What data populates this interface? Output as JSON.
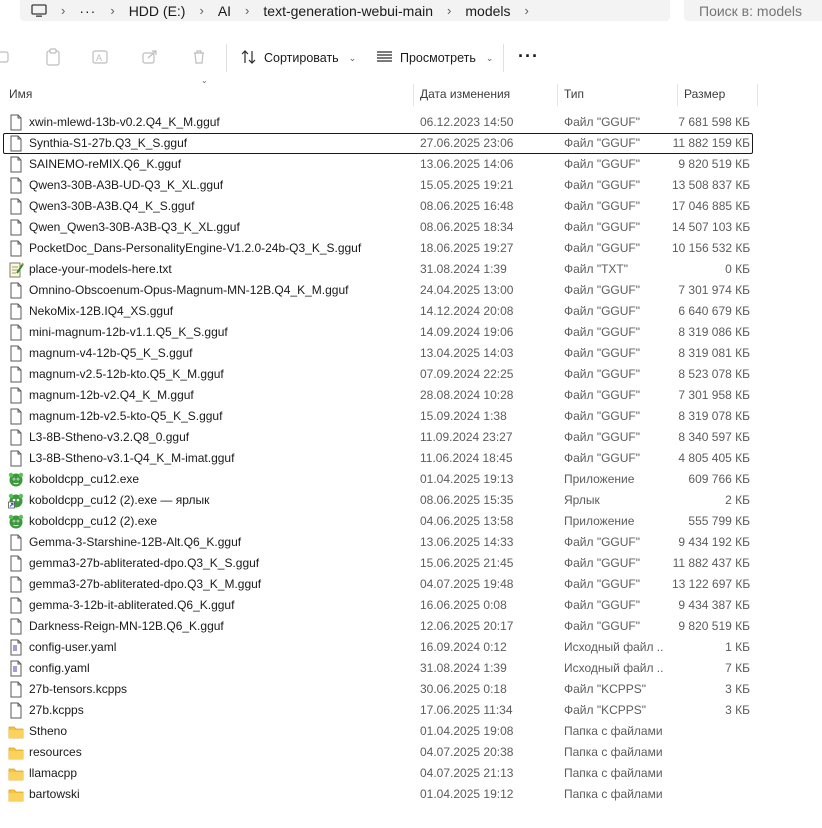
{
  "address": {
    "crumbs": [
      "HDD (E:)",
      "AI",
      "text-generation-webui-main",
      "models"
    ],
    "more": "···",
    "search_placeholder": "Поиск в: models"
  },
  "toolbar": {
    "sort_label": "Сортировать",
    "view_label": "Просмотреть",
    "more_label": "···"
  },
  "columns": {
    "name": "Имя",
    "date": "Дата изменения",
    "type": "Тип",
    "size": "Размер"
  },
  "files": [
    {
      "name": "xwin-mlewd-13b-v0.2.Q4_K_M.gguf",
      "date": "06.12.2023 14:50",
      "type": "Файл \"GGUF\"",
      "size": "7 681 598 КБ",
      "icon": "file-icon"
    },
    {
      "name": "Synthia-S1-27b.Q3_K_S.gguf",
      "date": "27.06.2025 23:06",
      "type": "Файл \"GGUF\"",
      "size": "11 882 159 КБ",
      "icon": "file-icon",
      "selected": true
    },
    {
      "name": "SAINEMO-reMIX.Q6_K.gguf",
      "date": "13.06.2025 14:06",
      "type": "Файл \"GGUF\"",
      "size": "9 820 519 КБ",
      "icon": "file-icon"
    },
    {
      "name": "Qwen3-30B-A3B-UD-Q3_K_XL.gguf",
      "date": "15.05.2025 19:21",
      "type": "Файл \"GGUF\"",
      "size": "13 508 837 КБ",
      "icon": "file-icon"
    },
    {
      "name": "Qwen3-30B-A3B.Q4_K_S.gguf",
      "date": "08.06.2025 16:48",
      "type": "Файл \"GGUF\"",
      "size": "17 046 885 КБ",
      "icon": "file-icon"
    },
    {
      "name": "Qwen_Qwen3-30B-A3B-Q3_K_XL.gguf",
      "date": "08.06.2025 18:34",
      "type": "Файл \"GGUF\"",
      "size": "14 507 103 КБ",
      "icon": "file-icon"
    },
    {
      "name": "PocketDoc_Dans-PersonalityEngine-V1.2.0-24b-Q3_K_S.gguf",
      "date": "18.06.2025 19:27",
      "type": "Файл \"GGUF\"",
      "size": "10 156 532 КБ",
      "icon": "file-icon"
    },
    {
      "name": "place-your-models-here.txt",
      "date": "31.08.2024 1:39",
      "type": "Файл \"TXT\"",
      "size": "0 КБ",
      "icon": "text-file-icon"
    },
    {
      "name": "Omnino-Obscoenum-Opus-Magnum-MN-12B.Q4_K_M.gguf",
      "date": "24.04.2025 13:00",
      "type": "Файл \"GGUF\"",
      "size": "7 301 974 КБ",
      "icon": "file-icon"
    },
    {
      "name": "NekoMix-12B.IQ4_XS.gguf",
      "date": "14.12.2024 20:08",
      "type": "Файл \"GGUF\"",
      "size": "6 640 679 КБ",
      "icon": "file-icon"
    },
    {
      "name": "mini-magnum-12b-v1.1.Q5_K_S.gguf",
      "date": "14.09.2024 19:06",
      "type": "Файл \"GGUF\"",
      "size": "8 319 086 КБ",
      "icon": "file-icon"
    },
    {
      "name": "magnum-v4-12b-Q5_K_S.gguf",
      "date": "13.04.2025 14:03",
      "type": "Файл \"GGUF\"",
      "size": "8 319 081 КБ",
      "icon": "file-icon"
    },
    {
      "name": "magnum-v2.5-12b-kto.Q5_K_M.gguf",
      "date": "07.09.2024 22:25",
      "type": "Файл \"GGUF\"",
      "size": "8 523 078 КБ",
      "icon": "file-icon"
    },
    {
      "name": "magnum-12b-v2.Q4_K_M.gguf",
      "date": "28.08.2024 10:28",
      "type": "Файл \"GGUF\"",
      "size": "7 301 958 КБ",
      "icon": "file-icon"
    },
    {
      "name": "magnum-12b-v2.5-kto-Q5_K_S.gguf",
      "date": "15.09.2024 1:38",
      "type": "Файл \"GGUF\"",
      "size": "8 319 078 КБ",
      "icon": "file-icon"
    },
    {
      "name": "L3-8B-Stheno-v3.2.Q8_0.gguf",
      "date": "11.09.2024 23:27",
      "type": "Файл \"GGUF\"",
      "size": "8 340 597 КБ",
      "icon": "file-icon"
    },
    {
      "name": "L3-8B-Stheno-v3.1-Q4_K_M-imat.gguf",
      "date": "11.06.2024 18:45",
      "type": "Файл \"GGUF\"",
      "size": "4 805 405 КБ",
      "icon": "file-icon"
    },
    {
      "name": "koboldcpp_cu12.exe",
      "date": "01.04.2025 19:13",
      "type": "Приложение",
      "size": "609 766 КБ",
      "icon": "kobold-app-icon"
    },
    {
      "name": "koboldcpp_cu12 (2).exe — ярлык",
      "date": "08.06.2025 15:35",
      "type": "Ярлык",
      "size": "2 КБ",
      "icon": "kobold-shortcut-icon"
    },
    {
      "name": "koboldcpp_cu12 (2).exe",
      "date": "04.06.2025 13:58",
      "type": "Приложение",
      "size": "555 799 КБ",
      "icon": "kobold-app-icon"
    },
    {
      "name": "Gemma-3-Starshine-12B-Alt.Q6_K.gguf",
      "date": "13.06.2025 14:33",
      "type": "Файл \"GGUF\"",
      "size": "9 434 192 КБ",
      "icon": "file-icon"
    },
    {
      "name": "gemma3-27b-abliterated-dpo.Q3_K_S.gguf",
      "date": "15.06.2025 21:45",
      "type": "Файл \"GGUF\"",
      "size": "11 882 437 КБ",
      "icon": "file-icon"
    },
    {
      "name": "gemma3-27b-abliterated-dpo.Q3_K_M.gguf",
      "date": "04.07.2025 19:48",
      "type": "Файл \"GGUF\"",
      "size": "13 122 697 КБ",
      "icon": "file-icon"
    },
    {
      "name": "gemma-3-12b-it-abliterated.Q6_K.gguf",
      "date": "16.06.2025 0:08",
      "type": "Файл \"GGUF\"",
      "size": "9 434 387 КБ",
      "icon": "file-icon"
    },
    {
      "name": "Darkness-Reign-MN-12B.Q6_K.gguf",
      "date": "12.06.2025 20:17",
      "type": "Файл \"GGUF\"",
      "size": "9 820 519 КБ",
      "icon": "file-icon"
    },
    {
      "name": "config-user.yaml",
      "date": "16.09.2024 0:12",
      "type": "Исходный файл ...",
      "size": "1 КБ",
      "icon": "yaml-file-icon"
    },
    {
      "name": "config.yaml",
      "date": "31.08.2024 1:39",
      "type": "Исходный файл ...",
      "size": "7 КБ",
      "icon": "yaml-file-icon"
    },
    {
      "name": "27b-tensors.kcpps",
      "date": "30.06.2025 0:18",
      "type": "Файл \"KCPPS\"",
      "size": "3 КБ",
      "icon": "file-icon"
    },
    {
      "name": "27b.kcpps",
      "date": "17.06.2025 11:34",
      "type": "Файл \"KCPPS\"",
      "size": "3 КБ",
      "icon": "file-icon"
    },
    {
      "name": "Stheno",
      "date": "01.04.2025 19:08",
      "type": "Папка с файлами",
      "size": "",
      "icon": "folder-icon"
    },
    {
      "name": "resources",
      "date": "04.07.2025 20:38",
      "type": "Папка с файлами",
      "size": "",
      "icon": "folder-icon"
    },
    {
      "name": "llamacpp",
      "date": "04.07.2025 21:13",
      "type": "Папка с файлами",
      "size": "",
      "icon": "folder-icon"
    },
    {
      "name": "bartowski",
      "date": "01.04.2025 19:12",
      "type": "Папка с файлами",
      "size": "",
      "icon": "folder-icon"
    }
  ]
}
